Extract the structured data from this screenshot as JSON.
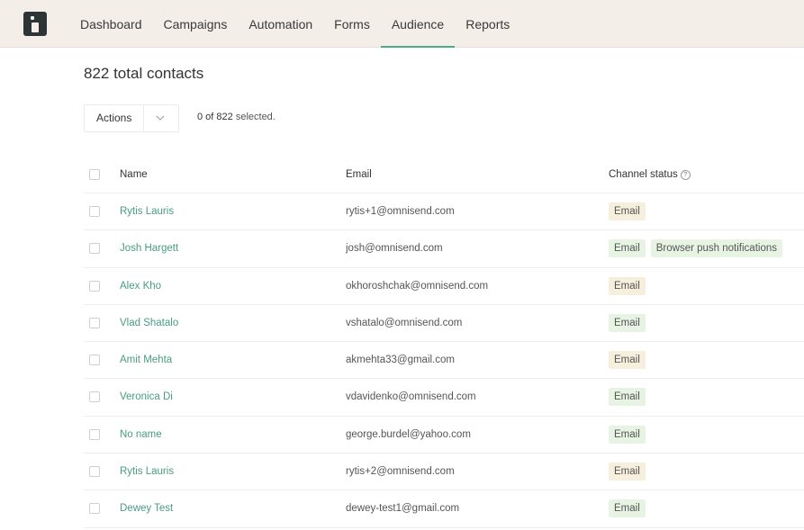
{
  "nav": {
    "items": [
      "Dashboard",
      "Campaigns",
      "Automation",
      "Forms",
      "Audience",
      "Reports"
    ],
    "active": "Audience"
  },
  "page": {
    "title": "822 total contacts",
    "actions_label": "Actions",
    "selected_count": "0 of 822",
    "selected_suffix": "selected."
  },
  "table": {
    "headers": {
      "name": "Name",
      "email": "Email",
      "status": "Channel status"
    },
    "rows": [
      {
        "name": "Rytis Lauris",
        "email": "rytis+1@omnisend.com",
        "channels": [
          {
            "label": "Email",
            "kind": "nonsub"
          }
        ]
      },
      {
        "name": "Josh Hargett",
        "email": "josh@omnisend.com",
        "channels": [
          {
            "label": "Email",
            "kind": "sub"
          },
          {
            "label": "Browser push notifications",
            "kind": "push"
          }
        ]
      },
      {
        "name": "Alex Kho",
        "email": "okhoroshchak@omnisend.com",
        "channels": [
          {
            "label": "Email",
            "kind": "nonsub"
          }
        ]
      },
      {
        "name": "Vlad Shatalo",
        "email": "vshatalo@omnisend.com",
        "channels": [
          {
            "label": "Email",
            "kind": "sub"
          }
        ]
      },
      {
        "name": "Amit Mehta",
        "email": "akmehta33@gmail.com",
        "channels": [
          {
            "label": "Email",
            "kind": "nonsub"
          }
        ]
      },
      {
        "name": "Veronica Di",
        "email": "vdavidenko@omnisend.com",
        "channels": [
          {
            "label": "Email",
            "kind": "sub"
          }
        ]
      },
      {
        "name": "No name",
        "email": "george.burdel@yahoo.com",
        "channels": [
          {
            "label": "Email",
            "kind": "sub"
          }
        ]
      },
      {
        "name": "Rytis Lauris",
        "email": "rytis+2@omnisend.com",
        "channels": [
          {
            "label": "Email",
            "kind": "nonsub"
          }
        ]
      },
      {
        "name": "Dewey Test",
        "email": "dewey-test1@gmail.com",
        "channels": [
          {
            "label": "Email",
            "kind": "sub"
          }
        ]
      }
    ]
  },
  "colors": {
    "accent": "#4caa8f",
    "topbar": "#f3efe8",
    "badge_subscribed": "#e7f4e3",
    "badge_nonsubscribed": "#f7efdd"
  }
}
